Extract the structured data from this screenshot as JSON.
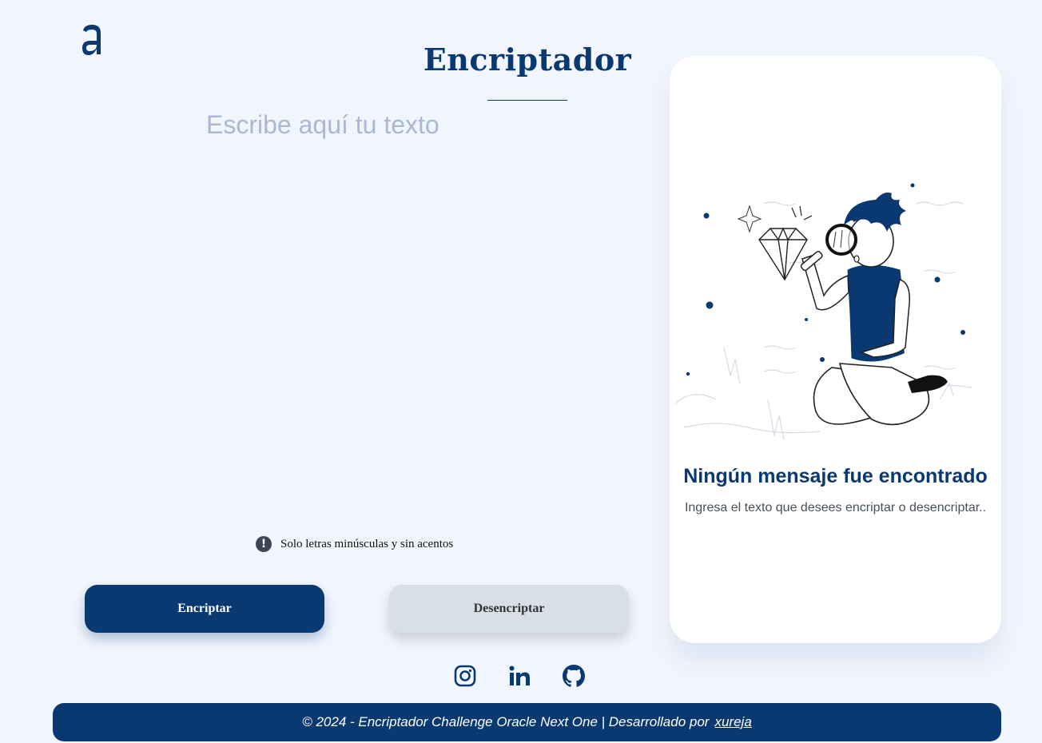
{
  "app": {
    "title": "Encriptador"
  },
  "input": {
    "placeholder": "Escribe aquí tu texto",
    "value": ""
  },
  "hint": {
    "icon": "exclamation-icon",
    "text": "Solo letras minúsculas y sin acentos"
  },
  "buttons": {
    "encrypt_label": "Encriptar",
    "decrypt_label": "Desencriptar"
  },
  "result": {
    "illustration": "boy-with-magnifying-glass-illustration",
    "title": "Ningún mensaje fue encontrado",
    "text": "Ingresa el texto que desees encriptar o desencriptar.."
  },
  "social": [
    {
      "name": "instagram-icon"
    },
    {
      "name": "linkedin-icon"
    },
    {
      "name": "github-icon"
    }
  ],
  "footer": {
    "text": "© 2024 - Encriptador Challenge Oracle Next One | Desarrollado por",
    "link_label": "xureja"
  },
  "colors": {
    "background": "#f1f5fd",
    "primary": "#0a3871",
    "secondary_button": "#d8dfe8",
    "placeholder": "#a9b9d3"
  }
}
